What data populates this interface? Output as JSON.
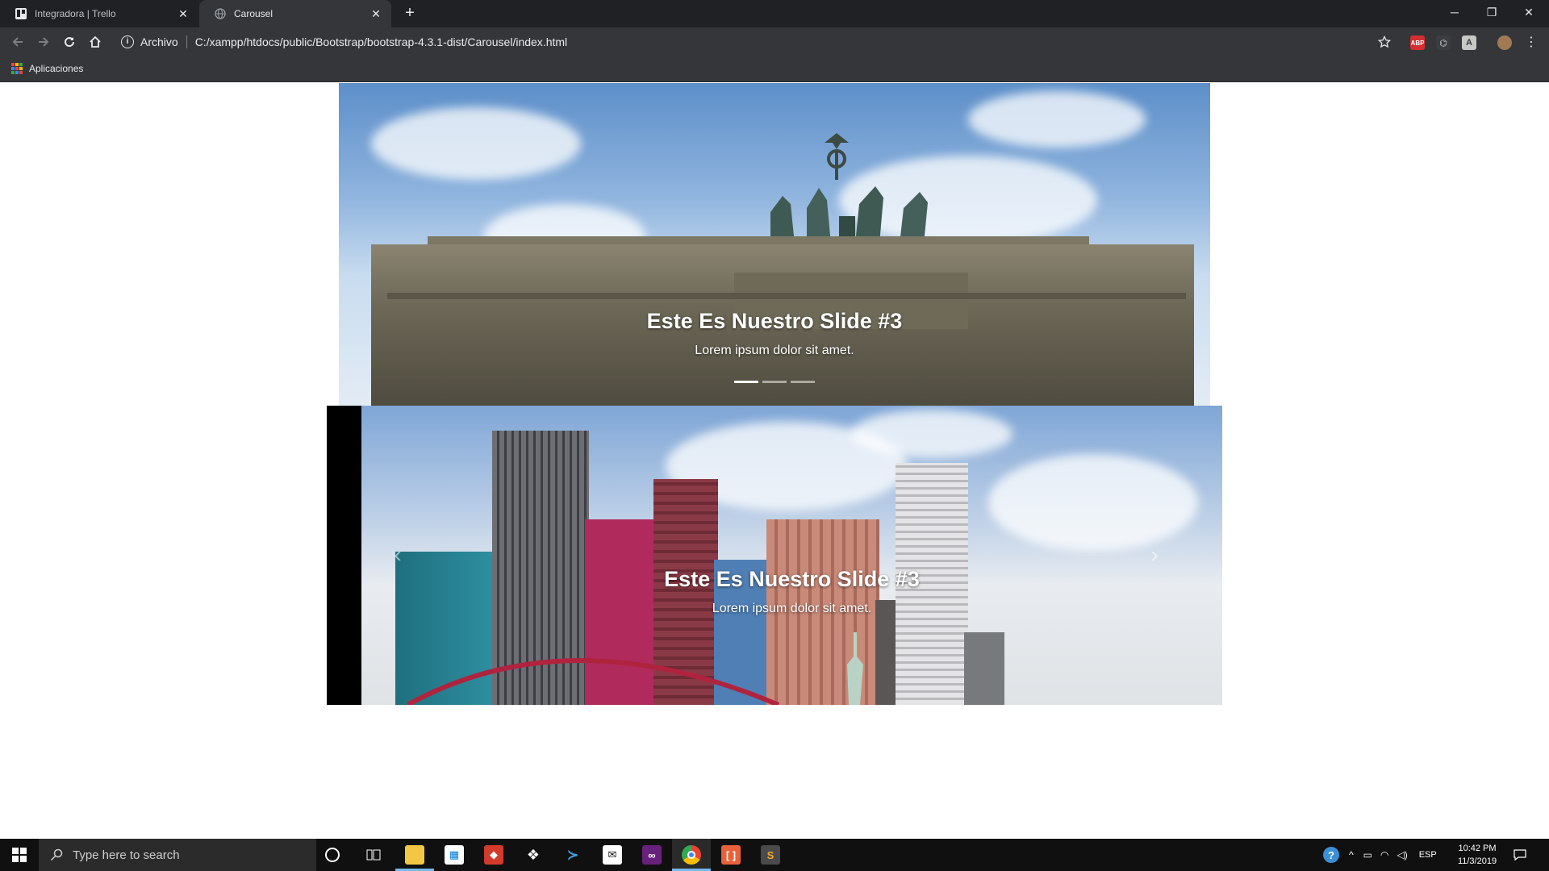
{
  "browser": {
    "tabs": [
      {
        "title": "Integradora | Trello",
        "active": false,
        "icon": "trello-icon"
      },
      {
        "title": "Carousel",
        "active": true,
        "icon": "globe-icon"
      }
    ],
    "address": {
      "scheme_label": "Archivo",
      "url": "C:/xampp/htdocs/public/Bootstrap/bootstrap-4.3.1-dist/Carousel/index.html"
    },
    "bookmarks": {
      "apps_label": "Aplicaciones"
    },
    "extensions": [
      "abp-icon",
      "pdf-icon",
      "extension-icon",
      "profile-avatar"
    ]
  },
  "page": {
    "slide1": {
      "title": "Este Es Nuestro Slide #3",
      "subtitle": "Lorem ipsum dolor sit amet.",
      "indicators": [
        true,
        false,
        false
      ]
    },
    "slide2": {
      "title": "Este Es Nuestro Slide #3",
      "subtitle": "Lorem ipsum dolor sit amet."
    }
  },
  "taskbar": {
    "search_placeholder": "Type here to search",
    "apps": [
      "cortana-icon",
      "task-view-icon",
      "file-explorer-icon",
      "store-icon",
      "git-icon",
      "dropbox-icon",
      "vscode-icon",
      "mail-icon",
      "visual-studio-icon",
      "chrome-icon",
      "brackets-icon",
      "sublime-icon"
    ],
    "tray": {
      "language": "ESP",
      "time": "10:42 PM",
      "date": "11/3/2019"
    }
  }
}
